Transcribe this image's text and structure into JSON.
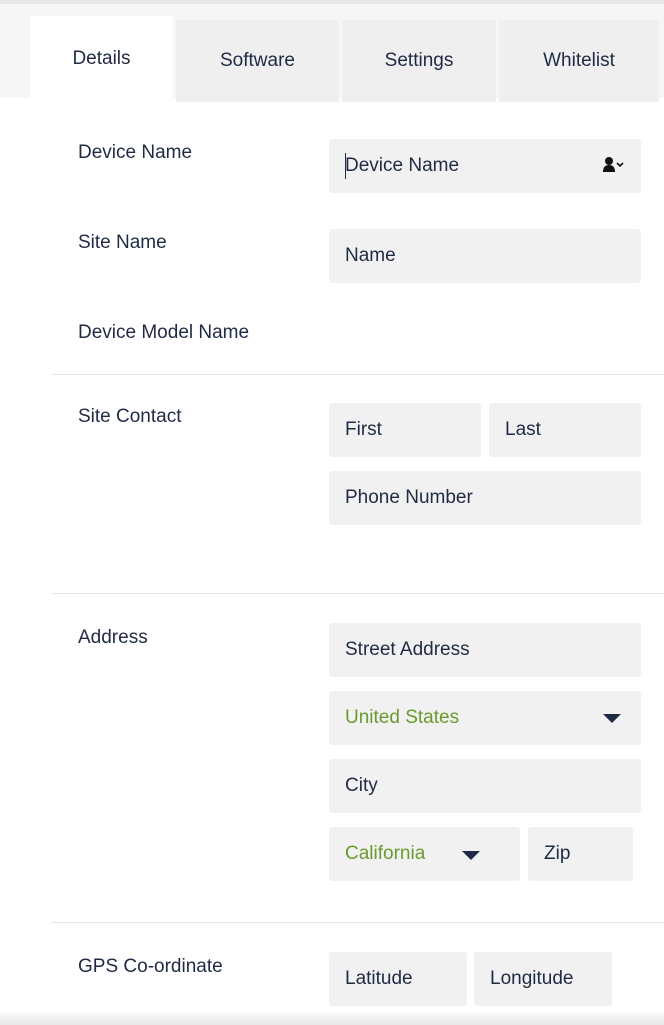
{
  "tabs": [
    {
      "label": "Details",
      "active": true
    },
    {
      "label": "Software",
      "active": false
    },
    {
      "label": "Settings",
      "active": false
    },
    {
      "label": "Whitelist",
      "active": false
    }
  ],
  "form": {
    "device_name": {
      "label": "Device Name",
      "placeholder": "Device Name",
      "icon": "user-icon"
    },
    "site_name": {
      "label": "Site Name",
      "placeholder": "Name"
    },
    "device_model": {
      "label": "Device Model Name"
    },
    "site_contact": {
      "label": "Site Contact",
      "first": "First",
      "last": "Last",
      "phone": "Phone Number"
    },
    "address": {
      "label": "Address",
      "street": "Street Address",
      "country": "United States",
      "city": "City",
      "state": "California",
      "zip": "Zip"
    },
    "gps": {
      "label": "GPS Co-ordinate",
      "latitude": "Latitude",
      "longitude": "Longitude"
    }
  },
  "colors": {
    "text": "#1f2a44",
    "select_value": "#6a9a2f",
    "field_bg": "#f1f1f1"
  }
}
